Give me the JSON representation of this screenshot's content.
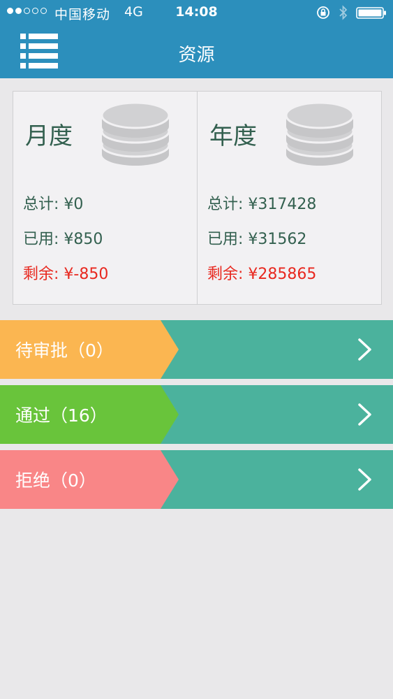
{
  "status_bar": {
    "carrier": "中国移动",
    "network": "4G",
    "time": "14:08",
    "signal_filled": 2,
    "signal_total": 5
  },
  "nav": {
    "title": "资源",
    "menu_icon": "list-menu-icon"
  },
  "monthly": {
    "title": "月度",
    "total_label": "总计:",
    "total_value": "¥0",
    "used_label": "已用:",
    "used_value": "¥850",
    "remaining_label": "剩余:",
    "remaining_value": "¥-850"
  },
  "yearly": {
    "title": "年度",
    "total_label": "总计:",
    "total_value": "¥317428",
    "used_label": "已用:",
    "used_value": "¥31562",
    "remaining_label": "剩余:",
    "remaining_value": "¥285865"
  },
  "rows": {
    "pending": {
      "label": "待审批（0）"
    },
    "approved": {
      "label": "通过（16）"
    },
    "rejected": {
      "label": "拒绝（0）"
    }
  },
  "colors": {
    "header": "#2c8fbc",
    "background": "#e9e8ea",
    "card_text": "#33604f",
    "negative": "#e8281f",
    "row_base": "#4bb29d",
    "pending_tag": "#fbb651",
    "approved_tag": "#69c43b",
    "rejected_tag": "#f98687"
  }
}
